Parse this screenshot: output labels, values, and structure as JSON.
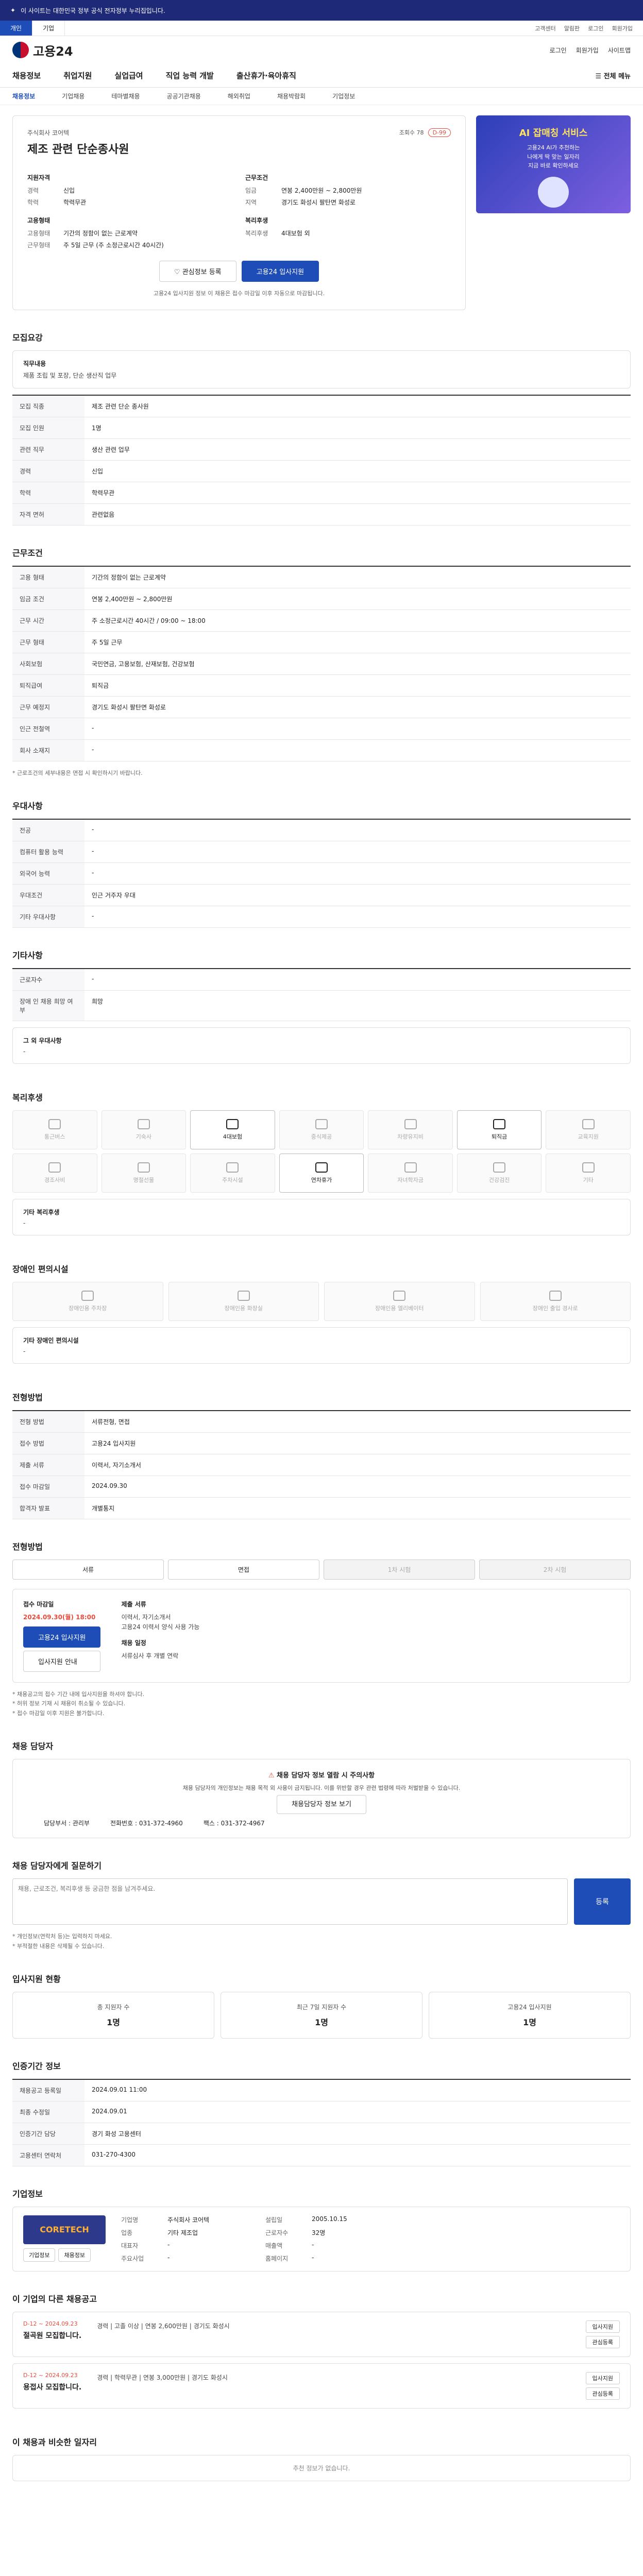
{
  "topbar": {
    "notice": "이 사이트는 대한민국 정부 공식 전자정부 누리집입니다."
  },
  "sitebar": {
    "tabs": [
      "개인",
      "기업"
    ],
    "links": [
      "고객센터",
      "알림판",
      "로그인",
      "회원가입"
    ]
  },
  "header": {
    "brand": "고용24",
    "util": [
      "로그인",
      "회원가입",
      "사이트맵"
    ]
  },
  "gnb": {
    "items": [
      "채용정보",
      "취업지원",
      "실업급여",
      "직업 능력 개발",
      "출산휴가·육아휴직"
    ],
    "all": "전체 메뉴"
  },
  "subnav": {
    "items": [
      "채용정보",
      "기업채용",
      "테마별채용",
      "공공기관채용",
      "해외취업",
      "채용박람회",
      "기업정보"
    ]
  },
  "job": {
    "company": "주식회사 코어텍",
    "title": "제조 관련 단순종사원",
    "views": "조회수 78",
    "status": "D-99",
    "g1_title": "지원자격",
    "g1": [
      [
        "경력",
        "신입"
      ],
      [
        "학력",
        "학력무관"
      ]
    ],
    "g2_title": "근무조건",
    "g2": [
      [
        "임금",
        "연봉 2,400만원 ~ 2,800만원"
      ],
      [
        "지역",
        "경기도 화성시 팔탄면 화성로"
      ]
    ],
    "g3_title": "고용형태",
    "g3": [
      [
        "고용형태",
        "기간의 정함이 없는 근로계약"
      ],
      [
        "근무형태",
        "주 5일 근무 (주 소정근로시간 40시간)"
      ]
    ],
    "g4_title": "복리후생",
    "g4": [
      [
        "복리후생",
        "4대보험 외"
      ]
    ],
    "btn_interest": "관심정보 등록",
    "btn_apply": "고용24 입사지원",
    "notice": "고용24 입사지원 정보 이 채용은 접수 마감일 이후 자동으로 마감됩니다."
  },
  "banner": {
    "title": "AI 잡매칭 서비스",
    "desc": "고용24 AI가 추천하는\n나에게 딱 맞는 일자리\n지금 바로 확인하세요"
  },
  "recruit": {
    "title": "모집요강",
    "duty_label": "직무내용",
    "duty": "제품 조립 및 포장, 단순 생산직 업무",
    "rows": [
      [
        "모집 직종",
        "제조 관련 단순 종사원"
      ],
      [
        "모집 인원",
        "1명"
      ],
      [
        "관련 직무",
        "생산 관련 업무"
      ],
      [
        "경력",
        "신입"
      ],
      [
        "학력",
        "학력무관"
      ],
      [
        "자격 면허",
        "관련없음"
      ]
    ]
  },
  "cond": {
    "title": "근무조건",
    "rows": [
      [
        "고용 형태",
        "기간의 정함이 없는 근로계약"
      ],
      [
        "임금 조건",
        "연봉 2,400만원 ~ 2,800만원"
      ],
      [
        "근무 시간",
        "주 소정근로시간 40시간 / 09:00 ~ 18:00"
      ],
      [
        "근무 형태",
        "주 5일 근무"
      ],
      [
        "사회보험",
        "국민연금, 고용보험, 산재보험, 건강보험"
      ],
      [
        "퇴직급여",
        "퇴직금"
      ],
      [
        "근무 예정지",
        "경기도 화성시 팔탄면 화성로"
      ],
      [
        "인근 전철역",
        "-"
      ],
      [
        "회사 소재지",
        "-"
      ]
    ],
    "footnote": "* 근로조건의 세부내용은 면접 시 확인하시기 바랍니다."
  },
  "prefer": {
    "title": "우대사항",
    "rows": [
      [
        "전공",
        "-"
      ],
      [
        "컴퓨터 활용 능력",
        "-"
      ],
      [
        "외국어 능력",
        "-"
      ],
      [
        "우대조건",
        "인근 거주자 우대"
      ],
      [
        "기타 우대사항",
        "-"
      ]
    ]
  },
  "other": {
    "title": "기타사항",
    "rows": [
      [
        "근로자수",
        "-"
      ],
      [
        "장애 인 채용 희망 여부",
        "희망"
      ]
    ],
    "box_label": "그 외 우대사항",
    "box_val": "-"
  },
  "welfare": {
    "title": "복리후생",
    "items": [
      {
        "name": "통근버스",
        "on": false
      },
      {
        "name": "기숙사",
        "on": false
      },
      {
        "name": "4대보험",
        "on": true
      },
      {
        "name": "중식제공",
        "on": false
      },
      {
        "name": "차량유지비",
        "on": false
      },
      {
        "name": "퇴직금",
        "on": true
      },
      {
        "name": "교육지원",
        "on": false
      },
      {
        "name": "경조사비",
        "on": false
      },
      {
        "name": "명절선물",
        "on": false
      },
      {
        "name": "주차시설",
        "on": false
      },
      {
        "name": "연차휴가",
        "on": true
      },
      {
        "name": "자녀학자금",
        "on": false
      },
      {
        "name": "건강검진",
        "on": false
      },
      {
        "name": "기타",
        "on": false
      }
    ],
    "box_label": "기타 복리후생",
    "box_val": "-"
  },
  "disab": {
    "title": "장애인 편의시설",
    "items": [
      "장애인용 주차장",
      "장애인용 화장실",
      "장애인용 엘리베이터",
      "장애인 출입 경사로"
    ],
    "box_label": "기타 장애인 편의시설",
    "box_val": "-"
  },
  "process": {
    "title": "전형방법",
    "rows": [
      [
        "전형 방법",
        "서류전형, 면접"
      ],
      [
        "접수 방법",
        "고용24 입사지원"
      ],
      [
        "제출 서류",
        "이력서, 자기소개서"
      ],
      [
        "접수 마감일",
        "2024.09.30"
      ],
      [
        "합격자 발표",
        "개별통지"
      ]
    ]
  },
  "apply": {
    "title": "전형방법",
    "tabs": [
      "서류",
      "면접",
      "1차 시험",
      "2차 시험"
    ],
    "col1_title": "접수 마감일",
    "col1_date": "2024.09.30(월) 18:00",
    "col1_btn": "고용24 입사지원",
    "col1_btn2": "입사지원 안내",
    "col2_title": "제출 서류",
    "col2": "이력서, 자기소개서\n고용24 이력서 양식 사용 가능",
    "col2_title2": "채용 일정",
    "col2_b": "서류심사 후 개별 연락",
    "notes": [
      "* 채용공고의 접수 기간 내에 입사지원을 하셔야 합니다.",
      "* 허위 정보 기재 시 채용이 취소될 수 있습니다.",
      "* 접수 마감일 이후 지원은 불가합니다."
    ]
  },
  "manager": {
    "title": "채용 담당자",
    "warn_a": "채용 담당자 정보 열람 시 주의사항",
    "desc": "채용 담당자의 개인정보는 채용 목적 외 사용이 금지됩니다. 이를 위반할 경우 관련 법령에 따라 처벌받을 수 있습니다.",
    "btn": "채용담당자 정보 보기",
    "name_label": "담당부서",
    "name_val": "관리부",
    "phone_label": "전화번호",
    "phone_val": "031-372-4960",
    "fax_label": "팩스",
    "fax_val": "031-372-4967"
  },
  "inquiry": {
    "title": "채용 담당자에게 질문하기",
    "placeholder": "채용, 근로조건, 복리후생 등 궁금한 점을 남겨주세요.",
    "submit": "등록",
    "notes": [
      "* 개인정보(연락처 등)는 입력하지 마세요.",
      "* 부적절한 내용은 삭제될 수 있습니다."
    ]
  },
  "stats": {
    "title": "입사지원 현황",
    "items": [
      [
        "총 지원자 수",
        "1명"
      ],
      [
        "최근 7일 지원자 수",
        "1명"
      ],
      [
        "고용24 입사지원",
        "1명"
      ]
    ]
  },
  "period": {
    "title": "인증기간 정보",
    "rows": [
      [
        "채용공고 등록일",
        "2024.09.01 11:00"
      ],
      [
        "최종 수정일",
        "2024.09.01"
      ],
      [
        "인증기간 담당",
        "경기 화성 고용센터"
      ],
      [
        "고용센터 연락처",
        "031-270-4300"
      ]
    ]
  },
  "company": {
    "title": "기업정보",
    "logo": "CORETECH",
    "btn_info": "기업정보",
    "btn_jobs": "채용정보",
    "rows": [
      [
        "기업명",
        "주식회사 코어텍"
      ],
      [
        "설립일",
        "2005.10.15"
      ],
      [
        "업종",
        "기타 제조업"
      ],
      [
        "근로자수",
        "32명"
      ],
      [
        "대표자",
        "-"
      ],
      [
        "매출액",
        "-"
      ],
      [
        "주요사업",
        "-"
      ],
      [
        "홈페이지",
        "-"
      ]
    ]
  },
  "more": {
    "title": "이 기업의 다른 채용공고",
    "items": [
      {
        "date": "D-12 ~ 2024.09.23",
        "title": "절곡원 모집합니다.",
        "meta": "경력 | 고졸 이상 | 연봉 2,600만원 | 경기도 화성시",
        "a1": "입사지원",
        "a2": "관심등록"
      },
      {
        "date": "D-12 ~ 2024.09.23",
        "title": "용접사 모집합니다.",
        "meta": "경력 | 학력무관 | 연봉 3,000만원 | 경기도 화성시",
        "a1": "입사지원",
        "a2": "관심등록"
      }
    ]
  },
  "recommend": {
    "title": "이 채용과 비슷한 일자리",
    "empty": "추천 정보가 없습니다."
  }
}
